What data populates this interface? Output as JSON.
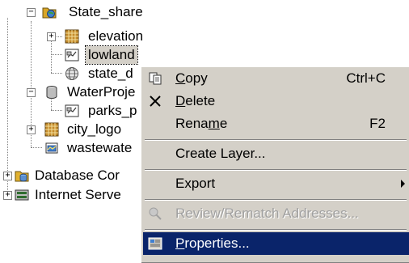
{
  "tree": {
    "items": [
      {
        "label": "State_share",
        "icon": "shared-folder-icon"
      },
      {
        "label": "elevation",
        "icon": "raster-grid-icon"
      },
      {
        "label": "lowland",
        "icon": "feature-class-icon"
      },
      {
        "label": "state_d",
        "icon": "globe-dataset-icon"
      },
      {
        "label": "WaterProje",
        "icon": "database-icon"
      },
      {
        "label": "parks_p",
        "icon": "feature-class-icon"
      },
      {
        "label": "city_logo",
        "icon": "raster-grid-icon"
      },
      {
        "label": "wastewate",
        "icon": "layer-file-icon"
      },
      {
        "label": "Database Cor",
        "icon": "database-connections-icon"
      },
      {
        "label": "Internet Serve",
        "icon": "internet-server-icon"
      }
    ],
    "selected": "lowland"
  },
  "context_menu": {
    "copy": {
      "pre": "",
      "accel": "C",
      "post": "opy",
      "shortcut": "Ctrl+C"
    },
    "delete": {
      "pre": "",
      "accel": "D",
      "post": "elete"
    },
    "rename": {
      "pre": "Rena",
      "accel": "m",
      "post": "e",
      "shortcut": "F2"
    },
    "create_layer": {
      "label": "Create Layer..."
    },
    "export": {
      "label": "Export"
    },
    "review": {
      "label": "Review/Rematch Addresses...",
      "disabled": true
    },
    "properties": {
      "pre": "",
      "accel": "P",
      "post": "roperties..."
    }
  },
  "colors": {
    "menu_bg": "#d4d0c8",
    "highlight_bg": "#0a246a",
    "highlight_fg": "#ffffff",
    "disabled_fg": "#a0a0a0"
  }
}
